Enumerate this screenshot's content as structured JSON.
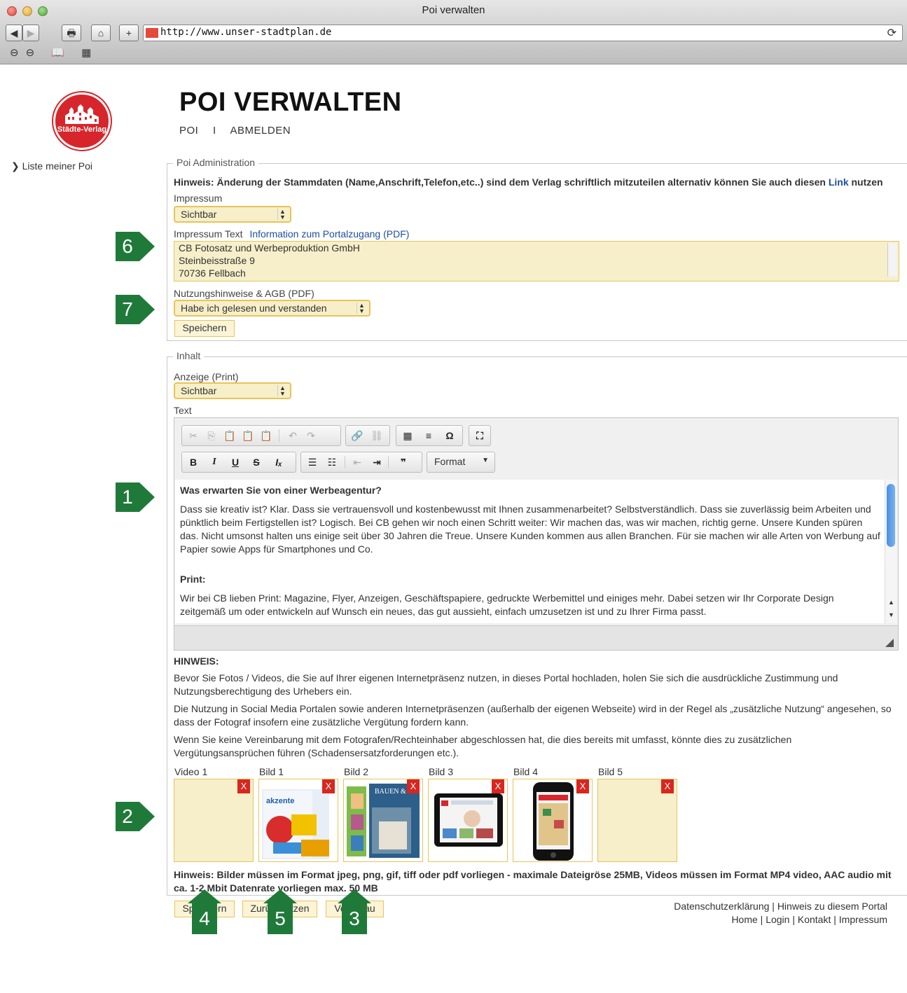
{
  "browser": {
    "window_title": "Poi verwalten",
    "url": "http://www.unser-stadtplan.de",
    "toolbar": {
      "back": "◀",
      "forward": "▶",
      "print": "🖶",
      "home": "⌂",
      "add": "+"
    },
    "reload": "⟳",
    "bookmarks": [
      "⊖⊖",
      "📖",
      "▦"
    ]
  },
  "logo": {
    "text": "Städte-Verlag"
  },
  "sidebar": {
    "link": "❯ Liste meiner Poi"
  },
  "header": {
    "title": "POI VERWALTEN",
    "nav": [
      "POI",
      "I",
      "ABMELDEN"
    ]
  },
  "admin": {
    "legend": "Poi Administration",
    "hint_prefix": "Hinweis: Änderung der Stammdaten (Name,Anschrift,Telefon,etc..) sind dem Verlag schriftlich mitzuteilen alternativ können Sie auch diesen ",
    "hint_link": "Link",
    "hint_suffix": " nutzen",
    "impressum_label": "Impressum",
    "impressum_value": "Sichtbar",
    "impressum_text_label": "Impressum Text",
    "portal_link": "Information zum Portalzugang (PDF)",
    "impressum_lines": [
      "CB Fotosatz und Werbeproduktion GmbH",
      "Steinbeisstraße 9",
      "70736 Fellbach"
    ],
    "agb_link": "Nutzungshinweise & AGB (PDF)",
    "agb_value": "Habe ich gelesen und verstanden",
    "save": "Speichern"
  },
  "content": {
    "legend": "Inhalt",
    "anzeige_label": "Anzeige (Print)",
    "anzeige_value": "Sichtbar",
    "text_label": "Text",
    "editor": {
      "format_label": "Format",
      "heading1": "Was erwarten Sie von einer Werbeagentur?",
      "paragraph1": "Dass sie kreativ ist? Klar. Dass sie vertrauensvoll und kostenbewusst mit Ihnen zusammenarbeitet? Selbstverständlich. Dass sie zuverlässig beim Arbeiten und pünktlich beim Fertigstellen ist? Logisch. Bei CB gehen wir noch einen Schritt weiter: Wir machen das, was wir machen, richtig gerne. Unsere Kunden spüren das. Nicht umsonst halten uns einige seit über 30 Jahren die Treue. Unsere Kunden kommen aus allen Branchen. Für sie machen wir alle Arten von Werbung auf Papier sowie Apps für Smartphones und Co.",
      "heading2": "Print:",
      "paragraph2": "Wir bei CB lieben Print: Magazine, Flyer, Anzeigen, Geschäftspapiere, gedruckte Werbemittel und einiges mehr. Dabei setzen wir Ihr Corporate Design zeitgemäß um oder entwickeln auf Wunsch ein neues, das gut aussieht, einfach umzusetzen ist und zu Ihrer Firma passt."
    },
    "hinweis_title": "HINWEIS:",
    "hinweis_p1": "Bevor Sie Fotos / Videos, die Sie auf Ihrer eigenen Internetpräsenz nutzen, in dieses Portal hochladen, holen Sie sich die ausdrückliche Zustimmung und Nutzungsberechtigung des Urhebers ein.",
    "hinweis_p2": "Die Nutzung in Social Media Portalen sowie anderen Internetpräsenzen (außerhalb der eigenen Webseite) wird in der Regel als „zusätzliche Nutzung“ angesehen, so dass der Fotograf insofern eine zusätzliche Vergütung fordern kann.",
    "hinweis_p3": "Wenn Sie keine Vereinbarung mit dem Fotografen/Rechteinhaber abgeschlossen hat, die dies bereits mit umfasst, könnte dies zu zusätzlichen Vergütungsansprüchen führen (Schadensersatzforderungen etc.).",
    "media": [
      {
        "label": "Video 1",
        "remove": "X"
      },
      {
        "label": "Bild 1",
        "remove": "X",
        "img_text": "akzente"
      },
      {
        "label": "Bild 2",
        "remove": "X",
        "img_text": "BAUEN & WOHNEN"
      },
      {
        "label": "Bild 3",
        "remove": "X"
      },
      {
        "label": "Bild 4",
        "remove": "X"
      },
      {
        "label": "Bild 5",
        "remove": "X"
      }
    ],
    "media_hint": "Hinweis: Bilder müssen im Format jpeg, png, gif, tiff oder pdf vorliegen - maximale Dateigröse 25MB, Videos müssen im Format MP4 video, AAC audio mit ca. 1-2 Mbit Datenrate vorliegen max. 50 MB",
    "buttons": {
      "save": "Speichern",
      "reset": "Zurücksetzen",
      "preview": "Vorschau"
    }
  },
  "callouts": {
    "c1": "1",
    "c2": "2",
    "c3": "3",
    "c4": "4",
    "c5": "5",
    "c6": "6",
    "c7": "7"
  },
  "footer": {
    "line1": "Datenschutzerklärung | Hinweis zu diesem Portal",
    "line2": "Home | Login | Kontakt | Impressum"
  },
  "colors": {
    "field_bg": "#f6efc9",
    "field_border": "#e9c35a",
    "callout_green": "#1f7a3a",
    "link_blue": "#1f4fa0",
    "remove_red": "#d9261f"
  }
}
